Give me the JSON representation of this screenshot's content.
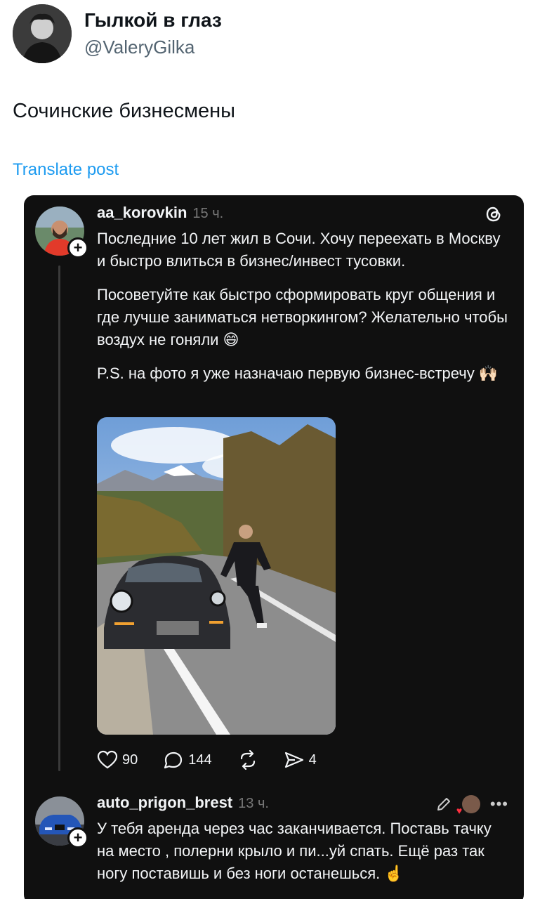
{
  "tweet": {
    "author_name": "Гылкой в глаз",
    "author_handle": "@ValeryGilka",
    "text": "Сочинские бизнесмены",
    "translate_label": "Translate post"
  },
  "threads_post": {
    "username": "aa_korovkin",
    "time": "15 ч.",
    "paragraphs": [
      "Последние 10 лет жил в Сочи. Хочу переехать в Москву и быстро влиться в бизнес/инвест тусовки.",
      "Посоветуйте как быстро сформировать круг общения и где лучше заниматься нетворкингом? Желательно чтобы воздух не гоняли 😄",
      "P.S. на фото я уже назначаю первую бизнес-встречу 🙌🏻"
    ],
    "likes": "90",
    "comments": "144",
    "shares": "4"
  },
  "reply": {
    "username": "auto_prigon_brest",
    "time": "13 ч.",
    "text": "У тебя аренда через час заканчивается. Поставь тачку на место , полерни крыло и пи...уй спать. Ещё раз так ногу поставишь и без ноги останешься. ☝️"
  },
  "colors": {
    "card_bg": "#101010",
    "link_blue": "#1d9bf0",
    "muted": "#777777"
  }
}
